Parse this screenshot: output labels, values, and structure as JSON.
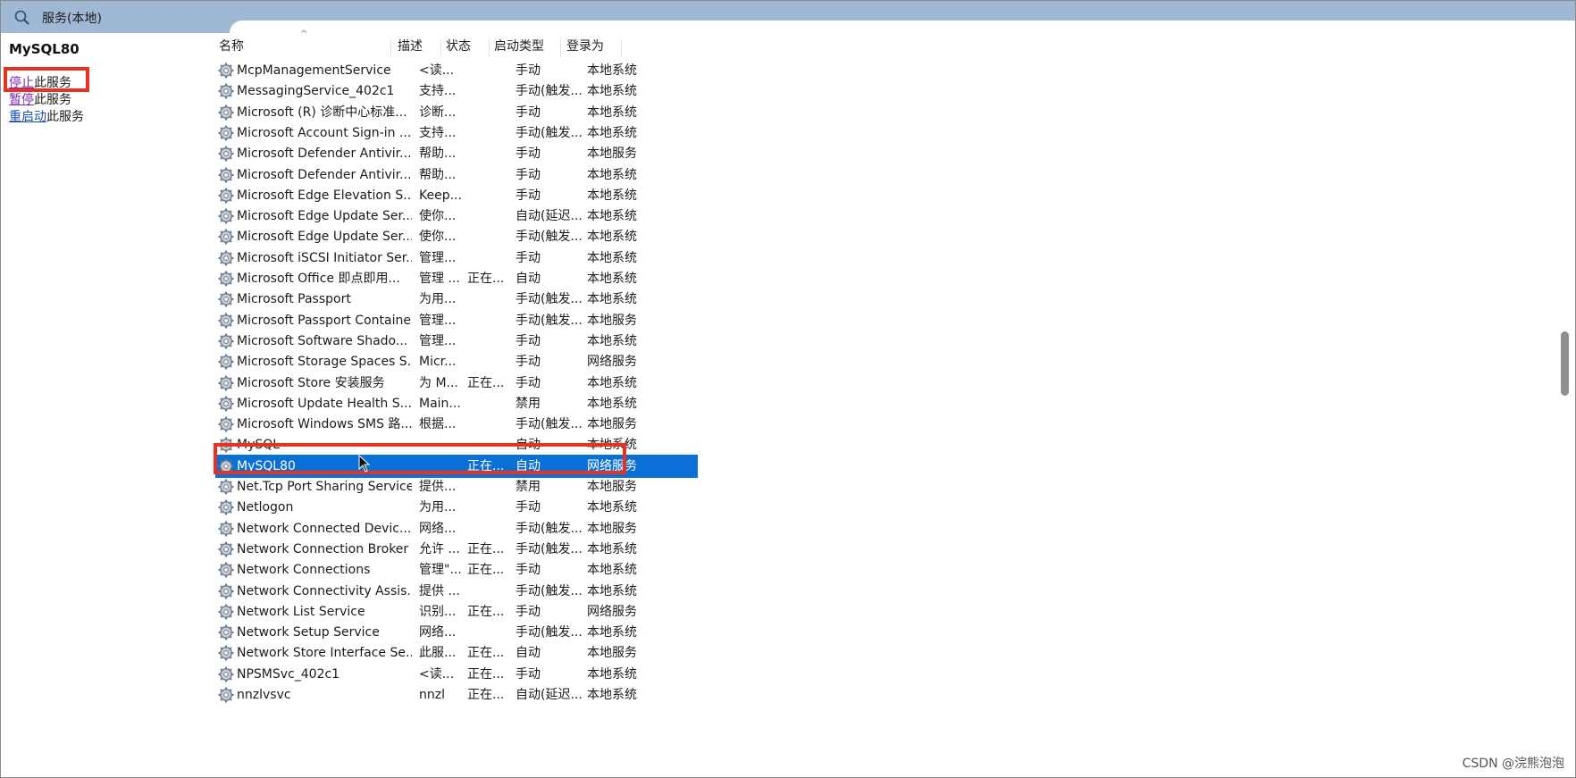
{
  "window": {
    "title": "服务(本地)",
    "title_icon": "magnifier-gear-icon"
  },
  "left_pane": {
    "service_name": "MySQL80",
    "actions": [
      {
        "link": "停止",
        "rest": "此服务"
      },
      {
        "link": "暂停",
        "rest": "此服务"
      },
      {
        "link": "重启动",
        "rest": "此服务"
      }
    ]
  },
  "columns": [
    "名称",
    "描述",
    "状态",
    "启动类型",
    "登录为"
  ],
  "sort_indicator": "^",
  "services": [
    {
      "name": "McpManagementService",
      "desc": "<读...",
      "status": "",
      "startup": "手动",
      "logon": "本地系统"
    },
    {
      "name": "MessagingService_402c1",
      "desc": "支持...",
      "status": "",
      "startup": "手动(触发...",
      "logon": "本地系统"
    },
    {
      "name": "Microsoft (R) 诊断中心标准...",
      "desc": "诊断...",
      "status": "",
      "startup": "手动",
      "logon": "本地系统"
    },
    {
      "name": "Microsoft Account Sign-in ...",
      "desc": "支持...",
      "status": "",
      "startup": "手动(触发...",
      "logon": "本地系统"
    },
    {
      "name": "Microsoft Defender Antivir...",
      "desc": "帮助...",
      "status": "",
      "startup": "手动",
      "logon": "本地服务"
    },
    {
      "name": "Microsoft Defender Antivir...",
      "desc": "帮助...",
      "status": "",
      "startup": "手动",
      "logon": "本地系统"
    },
    {
      "name": "Microsoft Edge Elevation S...",
      "desc": "Keep...",
      "status": "",
      "startup": "手动",
      "logon": "本地系统"
    },
    {
      "name": "Microsoft Edge Update Ser...",
      "desc": "使你...",
      "status": "",
      "startup": "自动(延迟...",
      "logon": "本地系统"
    },
    {
      "name": "Microsoft Edge Update Ser...",
      "desc": "使你...",
      "status": "",
      "startup": "手动(触发...",
      "logon": "本地系统"
    },
    {
      "name": "Microsoft iSCSI Initiator Ser...",
      "desc": "管理...",
      "status": "",
      "startup": "手动",
      "logon": "本地系统"
    },
    {
      "name": "Microsoft Office 即点即用...",
      "desc": "管理 ...",
      "status": "正在...",
      "startup": "自动",
      "logon": "本地系统"
    },
    {
      "name": "Microsoft Passport",
      "desc": "为用...",
      "status": "",
      "startup": "手动(触发...",
      "logon": "本地系统"
    },
    {
      "name": "Microsoft Passport Container",
      "desc": "管理...",
      "status": "",
      "startup": "手动(触发...",
      "logon": "本地服务"
    },
    {
      "name": "Microsoft Software Shado...",
      "desc": "管理...",
      "status": "",
      "startup": "手动",
      "logon": "本地系统"
    },
    {
      "name": "Microsoft Storage Spaces S...",
      "desc": "Micr...",
      "status": "",
      "startup": "手动",
      "logon": "网络服务"
    },
    {
      "name": "Microsoft Store 安装服务",
      "desc": "为 M...",
      "status": "正在...",
      "startup": "手动",
      "logon": "本地系统"
    },
    {
      "name": "Microsoft Update Health S...",
      "desc": "Main...",
      "status": "",
      "startup": "禁用",
      "logon": "本地系统"
    },
    {
      "name": "Microsoft Windows SMS 路...",
      "desc": "根据...",
      "status": "",
      "startup": "手动(触发...",
      "logon": "本地服务"
    },
    {
      "name": "MySQL",
      "desc": "",
      "status": "",
      "startup": "自动",
      "logon": "本地系统"
    },
    {
      "name": "MySQL80",
      "desc": "",
      "status": "正在...",
      "startup": "自动",
      "logon": "网络服务",
      "selected": true
    },
    {
      "name": "Net.Tcp Port Sharing Service",
      "desc": "提供...",
      "status": "",
      "startup": "禁用",
      "logon": "本地服务"
    },
    {
      "name": "Netlogon",
      "desc": "为用...",
      "status": "",
      "startup": "手动",
      "logon": "本地系统"
    },
    {
      "name": "Network Connected Devic...",
      "desc": "网络...",
      "status": "",
      "startup": "手动(触发...",
      "logon": "本地服务"
    },
    {
      "name": "Network Connection Broker",
      "desc": "允许 ...",
      "status": "正在...",
      "startup": "手动(触发...",
      "logon": "本地系统"
    },
    {
      "name": "Network Connections",
      "desc": "管理\"...",
      "status": "正在...",
      "startup": "手动",
      "logon": "本地系统"
    },
    {
      "name": "Network Connectivity Assis...",
      "desc": "提供 ...",
      "status": "",
      "startup": "手动(触发...",
      "logon": "本地系统"
    },
    {
      "name": "Network List Service",
      "desc": "识别...",
      "status": "正在...",
      "startup": "手动",
      "logon": "网络服务"
    },
    {
      "name": "Network Setup Service",
      "desc": "网络...",
      "status": "",
      "startup": "手动(触发...",
      "logon": "本地系统"
    },
    {
      "name": "Network Store Interface Se...",
      "desc": "此服...",
      "status": "正在...",
      "startup": "自动",
      "logon": "本地服务"
    },
    {
      "name": "NPSMSvc_402c1",
      "desc": "<读...",
      "status": "正在...",
      "startup": "手动",
      "logon": "本地系统"
    },
    {
      "name": "nnzlvsvc",
      "desc": "nnzl",
      "status": "正在...",
      "startup": "自动(延迟...",
      "logon": "本地系统"
    }
  ],
  "row_icon": "gear-service-icon",
  "watermark": "CSDN @浣熊泡泡",
  "colors": {
    "selection": "#0a6fd6",
    "highlight_box": "#e8311f",
    "titlebar": "#9fb8d4"
  }
}
